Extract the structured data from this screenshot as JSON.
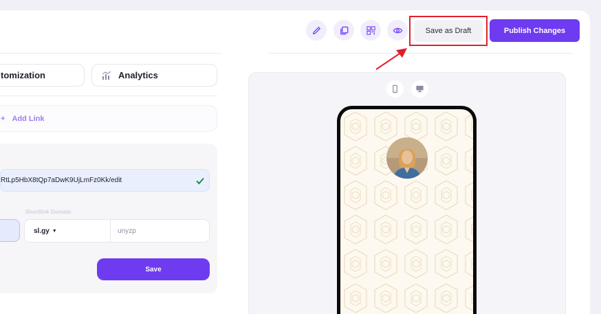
{
  "tabs": {
    "customization": "tomization",
    "analytics": "Analytics"
  },
  "add_link": {
    "label": "Add Link",
    "icon": "plus-icon"
  },
  "form": {
    "url_value": "RtLp5HbX8tQp7aDwK9UjLmFz0Kk/edit",
    "shortlink_label": "Shortlink Domain",
    "domain_selected": "sl.gy",
    "slug_value": "unyzp",
    "save_label": "Save"
  },
  "toolbar": {
    "draft_label": "Save as Draft",
    "publish_label": "Publish Changes",
    "icons": [
      "edit-icon",
      "copy-icon",
      "qr-code-icon",
      "eye-icon"
    ]
  },
  "preview": {
    "device_icons": [
      "mobile-icon",
      "desktop-icon"
    ]
  },
  "colors": {
    "accent": "#6e3bf0",
    "highlight": "#e0202a",
    "check": "#1a8f3e"
  }
}
